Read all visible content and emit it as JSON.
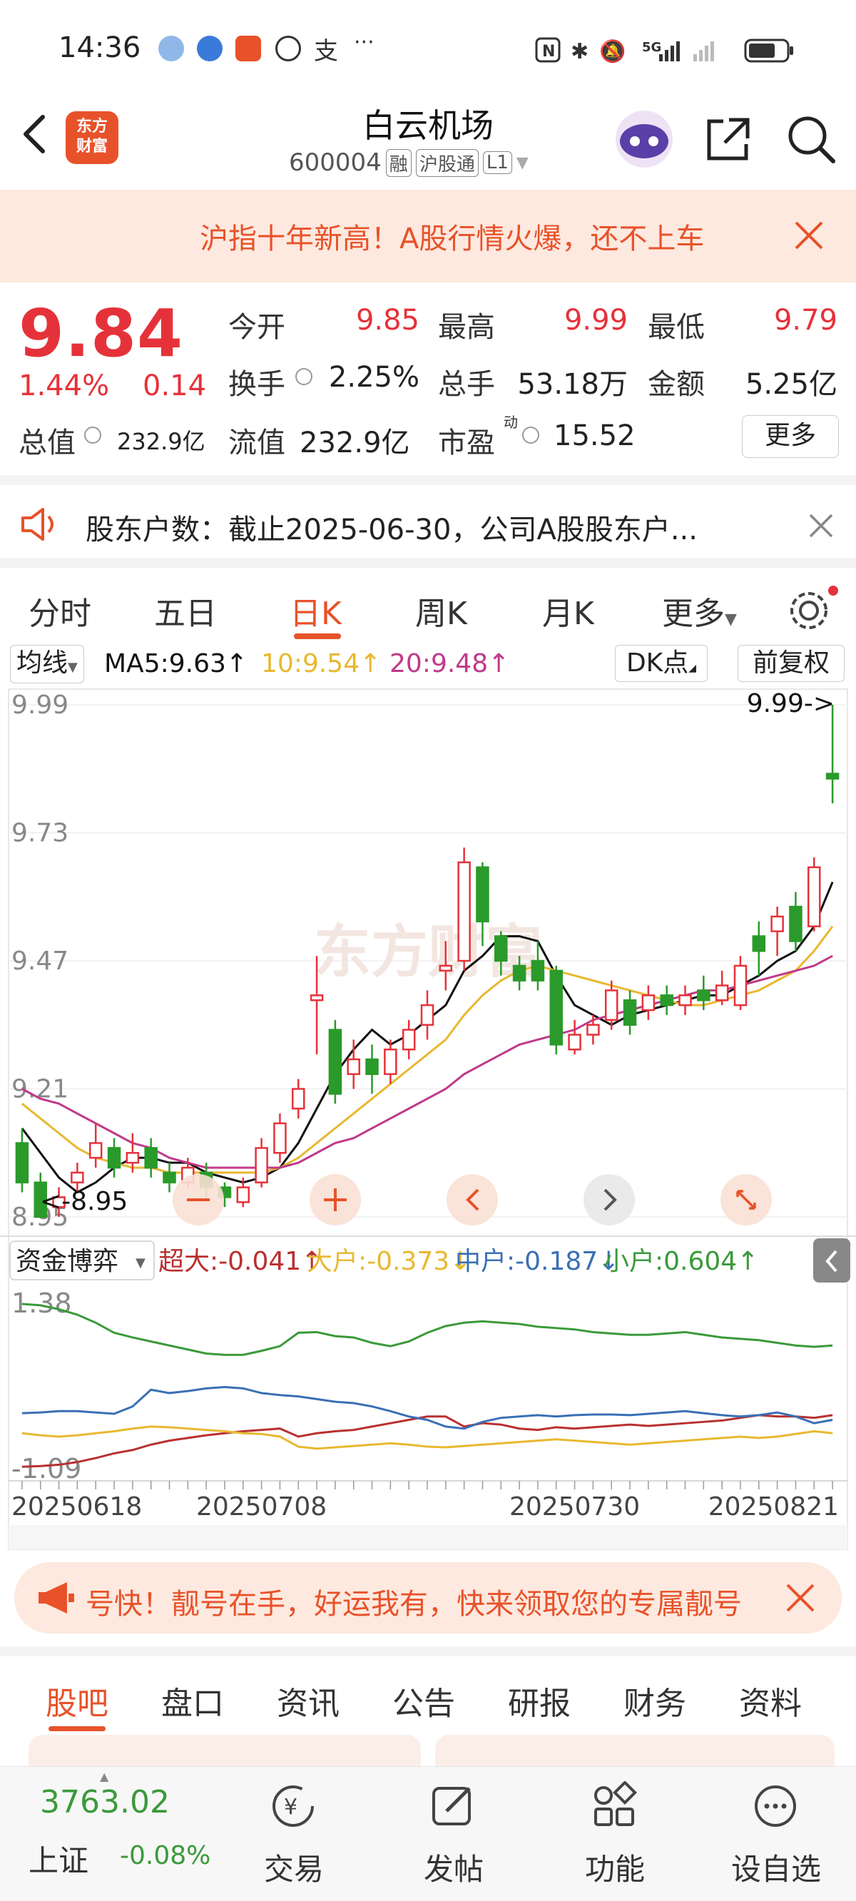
{
  "status_bar": {
    "time": "14:36",
    "network": "5G"
  },
  "header": {
    "title": "白云机场",
    "code": "600004",
    "tags": [
      "融",
      "沪股通",
      "L1"
    ],
    "logo_text": [
      "东方",
      "财富"
    ]
  },
  "banner": {
    "text": "沪指十年新高！A股行情火爆，还不上车"
  },
  "quote": {
    "price": "9.84",
    "change_pct": "1.44%",
    "change": "0.14",
    "open_label": "今开",
    "open": "9.85",
    "high_label": "最高",
    "high": "9.99",
    "low_label": "最低",
    "low": "9.79",
    "turnover_label": "换手",
    "turnover": "2.25%",
    "volume_label": "总手",
    "volume": "53.18万",
    "amount_label": "金额",
    "amount": "5.25亿",
    "mktcap_label": "总值",
    "mktcap": "232.9亿",
    "float_label": "流值",
    "float": "232.9亿",
    "pe_label": "市盈",
    "pe_sup": "动",
    "pe": "15.52",
    "more_label": "更多"
  },
  "notice": {
    "text": "股东户数：截止2025-06-30，公司A股股东户..."
  },
  "kline_tabs": {
    "items": [
      "分时",
      "五日",
      "日K",
      "周K",
      "月K",
      "更多"
    ],
    "active": "日K"
  },
  "ma": {
    "selector": "均线",
    "ma5": "MA5:9.63↑",
    "ma10": "10:9.54↑",
    "ma20": "20:9.48↑",
    "dk_label": "DK点",
    "fq_label": "前复权"
  },
  "chart_data": [
    {
      "type": "candlestick",
      "y_ticks": [
        "9.99",
        "9.73",
        "9.47",
        "9.21",
        "8.95"
      ],
      "ylim": [
        8.95,
        9.99
      ],
      "max_label": "9.99->",
      "min_label": "<-8.95",
      "x_ticks": [
        "20250618",
        "20250708",
        "20250730",
        "20250821"
      ],
      "watermark": "东方财富",
      "series": [
        {
          "name": "MA5",
          "color": "#111111"
        },
        {
          "name": "10",
          "color": "#e8b830"
        },
        {
          "name": "20",
          "color": "#c0398a"
        }
      ],
      "candles": [
        [
          9.1,
          9.02,
          9.13,
          9.0
        ],
        [
          9.02,
          8.95,
          9.04,
          8.95
        ],
        [
          8.97,
          8.99,
          9.01,
          8.95
        ],
        [
          9.02,
          9.04,
          9.06,
          9.0
        ],
        [
          9.07,
          9.1,
          9.14,
          9.05
        ],
        [
          9.09,
          9.05,
          9.11,
          9.03
        ],
        [
          9.06,
          9.08,
          9.12,
          9.04
        ],
        [
          9.09,
          9.05,
          9.11,
          9.03
        ],
        [
          9.04,
          9.02,
          9.06,
          9.0
        ],
        [
          9.02,
          9.05,
          9.07,
          9.01
        ],
        [
          9.04,
          9.01,
          9.06,
          8.99
        ],
        [
          9.01,
          8.99,
          9.02,
          8.97
        ],
        [
          8.98,
          9.01,
          9.03,
          8.97
        ],
        [
          9.02,
          9.09,
          9.11,
          9.01
        ],
        [
          9.08,
          9.14,
          9.16,
          9.06
        ],
        [
          9.17,
          9.21,
          9.23,
          9.15
        ],
        [
          9.39,
          9.4,
          9.48,
          9.28
        ],
        [
          9.33,
          9.2,
          9.35,
          9.18
        ],
        [
          9.24,
          9.27,
          9.31,
          9.21
        ],
        [
          9.27,
          9.24,
          9.3,
          9.2
        ],
        [
          9.24,
          9.29,
          9.31,
          9.22
        ],
        [
          9.29,
          9.33,
          9.35,
          9.27
        ],
        [
          9.34,
          9.38,
          9.41,
          9.31
        ],
        [
          9.45,
          9.46,
          9.51,
          9.41
        ],
        [
          9.47,
          9.67,
          9.7,
          9.45
        ],
        [
          9.66,
          9.55,
          9.67,
          9.5
        ],
        [
          9.52,
          9.47,
          9.53,
          9.44
        ],
        [
          9.46,
          9.43,
          9.48,
          9.41
        ],
        [
          9.47,
          9.43,
          9.51,
          9.41
        ],
        [
          9.45,
          9.3,
          9.46,
          9.28
        ],
        [
          9.29,
          9.32,
          9.35,
          9.28
        ],
        [
          9.32,
          9.34,
          9.36,
          9.3
        ],
        [
          9.35,
          9.41,
          9.43,
          9.33
        ],
        [
          9.39,
          9.34,
          9.41,
          9.32
        ],
        [
          9.37,
          9.4,
          9.42,
          9.35
        ],
        [
          9.4,
          9.38,
          9.42,
          9.36
        ],
        [
          9.38,
          9.4,
          9.42,
          9.36
        ],
        [
          9.41,
          9.39,
          9.44,
          9.37
        ],
        [
          9.39,
          9.42,
          9.45,
          9.38
        ],
        [
          9.38,
          9.46,
          9.48,
          9.37
        ],
        [
          9.52,
          9.49,
          9.55,
          9.44
        ],
        [
          9.53,
          9.56,
          9.58,
          9.48
        ],
        [
          9.58,
          9.51,
          9.61,
          9.49
        ],
        [
          9.54,
          9.66,
          9.68,
          9.53
        ],
        [
          9.85,
          9.84,
          9.99,
          9.79
        ]
      ],
      "ma5": [
        9.13,
        9.08,
        9.03,
        9.0,
        9.02,
        9.05,
        9.07,
        9.07,
        9.06,
        9.06,
        9.04,
        9.03,
        9.02,
        9.03,
        9.05,
        9.1,
        9.17,
        9.24,
        9.29,
        9.33,
        9.3,
        9.32,
        9.35,
        9.38,
        9.45,
        9.48,
        9.52,
        9.52,
        9.51,
        9.44,
        9.38,
        9.36,
        9.34,
        9.36,
        9.37,
        9.38,
        9.39,
        9.4,
        9.4,
        9.42,
        9.44,
        9.47,
        9.49,
        9.54,
        9.63
      ],
      "ma10": [
        9.18,
        9.15,
        9.12,
        9.09,
        9.07,
        9.06,
        9.05,
        9.05,
        9.04,
        9.04,
        9.04,
        9.04,
        9.04,
        9.04,
        9.05,
        9.07,
        9.1,
        9.13,
        9.16,
        9.19,
        9.22,
        9.25,
        9.28,
        9.31,
        9.36,
        9.4,
        9.43,
        9.45,
        9.46,
        9.45,
        9.44,
        9.43,
        9.42,
        9.41,
        9.4,
        9.39,
        9.38,
        9.38,
        9.39,
        9.4,
        9.41,
        9.43,
        9.45,
        9.49,
        9.54
      ],
      "ma20": [
        9.21,
        9.19,
        9.18,
        9.16,
        9.14,
        9.12,
        9.1,
        9.09,
        9.07,
        9.06,
        9.05,
        9.05,
        9.05,
        9.05,
        9.05,
        9.06,
        9.08,
        9.1,
        9.11,
        9.13,
        9.15,
        9.17,
        9.19,
        9.21,
        9.24,
        9.26,
        9.28,
        9.3,
        9.31,
        9.32,
        9.33,
        9.35,
        9.36,
        9.37,
        9.38,
        9.39,
        9.4,
        9.41,
        9.41,
        9.42,
        9.43,
        9.44,
        9.45,
        9.46,
        9.48
      ]
    },
    {
      "type": "line",
      "title": "资金博弈",
      "y_ticks": [
        "1.38",
        "-1.09"
      ],
      "ylim": [
        -1.09,
        1.38
      ],
      "series": [
        {
          "name": "超大",
          "label": "超大:-0.041↑",
          "color": "#b93030"
        },
        {
          "name": "大户",
          "label": "大户:-0.373↓",
          "color": "#e8b830"
        },
        {
          "name": "中户",
          "label": "中户:-0.187↓",
          "color": "#3a6fb5"
        },
        {
          "name": "小户",
          "label": "小户:0.604↑",
          "color": "#3a9a3a"
        }
      ]
    }
  ],
  "chart_controls": [
    "zoom-out",
    "zoom-in",
    "prev",
    "next",
    "fullscreen"
  ],
  "promo": {
    "text": "号快！靓号在手，好运我有，快来领取您的专属靓号"
  },
  "bottom_tabs": {
    "items": [
      "股吧",
      "盘口",
      "资讯",
      "公告",
      "研报",
      "财务",
      "资料"
    ],
    "active": "股吧"
  },
  "nav": {
    "index_value": "3763.02",
    "index_name": "上证",
    "index_change": "-0.08%",
    "items": [
      "交易",
      "发帖",
      "功能",
      "设自选"
    ]
  }
}
